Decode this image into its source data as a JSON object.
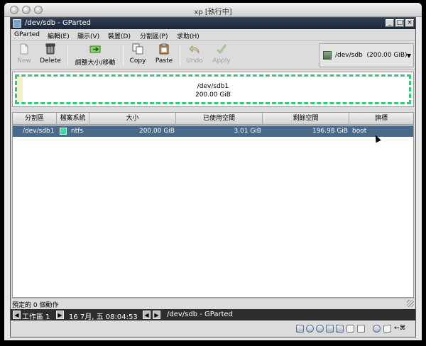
{
  "outer_window": {
    "title": "xp [執行中]"
  },
  "window": {
    "title": "/dev/sdb - GParted",
    "controls": [
      "_",
      "□",
      "×"
    ]
  },
  "menu": [
    {
      "label": "GParted"
    },
    {
      "label": "編輯(E)"
    },
    {
      "label": "顯示(V)"
    },
    {
      "label": "裝置(D)"
    },
    {
      "label": "分割區(P)"
    },
    {
      "label": "求助(H)"
    }
  ],
  "toolbar": {
    "new": "New",
    "delete": "Delete",
    "resize": "調整大小/移動",
    "copy": "Copy",
    "paste": "Paste",
    "undo": "Undo",
    "apply": "Apply"
  },
  "device_selector": {
    "label": "/dev/sdb",
    "size": "(200.00 GiB)"
  },
  "disk_map": {
    "partition_name": "/dev/sdb1",
    "partition_size": "200.00 GiB"
  },
  "table": {
    "headers": [
      "分割區",
      "檔案系統",
      "大小",
      "已使用空間",
      "剩餘空間",
      "旗標"
    ],
    "rows": [
      {
        "partition": "/dev/sdb1",
        "filesystem": "ntfs",
        "filesystem_color": "#3ed8a0",
        "size": "200.00 GiB",
        "used": "3.01 GiB",
        "unused": "196.98 GiB",
        "flags": "boot"
      }
    ]
  },
  "status": {
    "text": "預定的 0 個動作"
  },
  "taskbar": {
    "workspace": "工作區 1",
    "clock": "16 7月, 五 08:04:53",
    "task": "/dev/sdb - GParted"
  },
  "tray": {
    "shortcut": "←⌘"
  },
  "colors": {
    "selection": "#4a6a8c",
    "partition_border": "#36c87a",
    "titlebar": "#1c2839"
  }
}
